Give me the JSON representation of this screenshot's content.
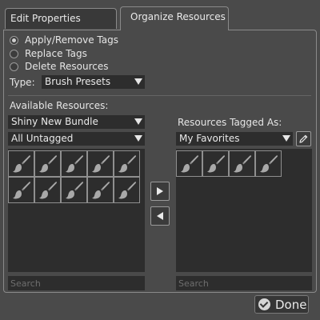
{
  "tabs": [
    {
      "label": "Edit Properties",
      "active": false
    },
    {
      "label": "Organize Resources",
      "active": true
    }
  ],
  "actions": {
    "options": [
      {
        "label": "Apply/Remove Tags",
        "checked": true
      },
      {
        "label": "Replace Tags",
        "checked": false
      },
      {
        "label": "Delete Resources",
        "checked": false
      }
    ]
  },
  "type": {
    "label": "Type:",
    "value": "Brush Presets"
  },
  "available": {
    "label": "Available Resources:",
    "bundle": "Shiny New Bundle",
    "filter": "All Untagged",
    "item_count": 10,
    "item_icon": "brush-icon",
    "search_placeholder": "Search"
  },
  "tagged": {
    "label": "Resources Tagged As:",
    "tag": "My Favorites",
    "item_count": 4,
    "item_icon": "brush-icon",
    "search_placeholder": "Search"
  },
  "done_button": {
    "label": "Done"
  },
  "colors": {
    "background": "#4a4a4a",
    "field": "#2d2d2d",
    "border": "#8a8a8a",
    "text": "#e6e6e6"
  }
}
